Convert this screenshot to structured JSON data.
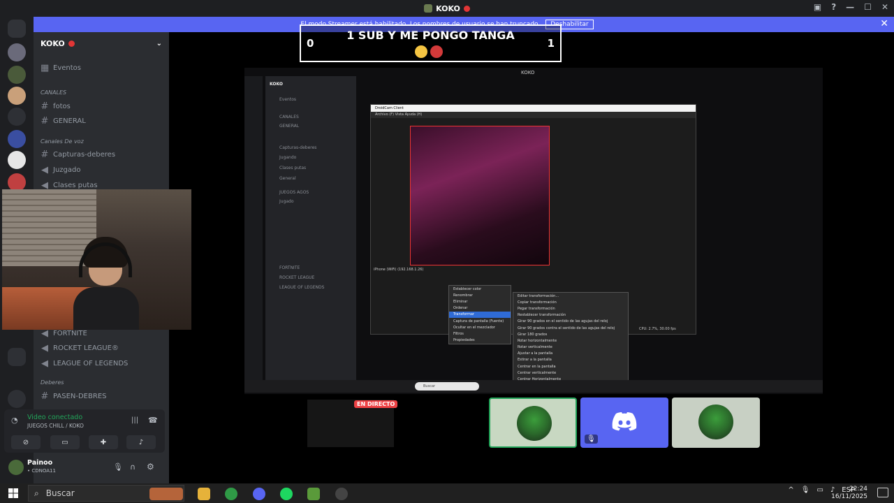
{
  "window": {
    "title": "KOKO"
  },
  "banner": {
    "text": "El modo Streamer está habilitado. Los nombres de usuario se han truncado.",
    "button": "Deshabilitar"
  },
  "guild": {
    "name": "KOKO"
  },
  "channels": {
    "events": "Eventos",
    "cat_channels": "CANALES",
    "fotos": "fotos",
    "general": "GENERAL",
    "cat_homework": "Canales De voz",
    "capturas": "Capturas-deberes",
    "jugando": "Juzgado",
    "clases": "Clases putas",
    "fortnite": "FORTNITE",
    "rocket": "ROCKET LEAGUE®",
    "lol": "LEAGUE OF LEGENDS",
    "cat_deberes": "Deberes",
    "pasen": "PASEN-DEBRES"
  },
  "voice": {
    "status": "Video conectado",
    "sub": "JUEGOS CHILL / KOKO"
  },
  "user": {
    "name": "Painoo",
    "status": "• CDNOA11"
  },
  "overlay": {
    "title": "1 SUB Y ME PONGO TANGA",
    "left_count": "0",
    "right_count": "1"
  },
  "stream": {
    "window_title": "KOKO",
    "droidcam_title": "DroidCam Client",
    "droidcam_menu": "Archivo (F)    Vista    Ayuda (H)",
    "live_badge": "EN DIRECTO",
    "nested_search": "Buscar",
    "nested_chan_head": "KOKO",
    "nested_items": [
      "Eventos",
      "CANALES",
      "GENERAL",
      "Capturas-deberes",
      "Jugando",
      "Clases putas",
      "General",
      "JUEGOS AGOS",
      "Jugado",
      "FORTNITE",
      "ROCKET LEAGUE",
      "LEAGUE OF LEGENDS"
    ],
    "source_label": "iPhone (WiFi) (192.168.1.26)",
    "ctx_menu_1": [
      "Establecer color",
      "Renombrar",
      "Eliminar",
      "Ordenar",
      "Transformar",
      "Captura de pantalla (Fuente)",
      "Ocultar en el mezclador",
      "Filtros",
      "Propiedades"
    ],
    "ctx_menu_2": [
      "Editar transformación...",
      "Copiar transformación",
      "Pegar transformación",
      "Restablecer transformación",
      "Girar 90 grados en el sentido de las agujas del reloj",
      "Girar 90 grados contra el sentido de las agujas del reloj",
      "Girar 180 grados",
      "Rotar horizontalmente",
      "Rotar verticalmente",
      "Ajustar a la pantalla",
      "Estirar a la pantalla",
      "Centrar en la pantalla",
      "Centrar verticalmente",
      "Centrar Horizontalmente"
    ],
    "cpu": "CPU: 2.7%, 30.00 fps"
  },
  "taskbar": {
    "search": "Buscar",
    "lang": "ESP",
    "time": "22:24",
    "date": "16/11/2025"
  },
  "colors": {
    "blurple": "#5865f2",
    "green": "#23a55a",
    "red": "#ed4245"
  }
}
